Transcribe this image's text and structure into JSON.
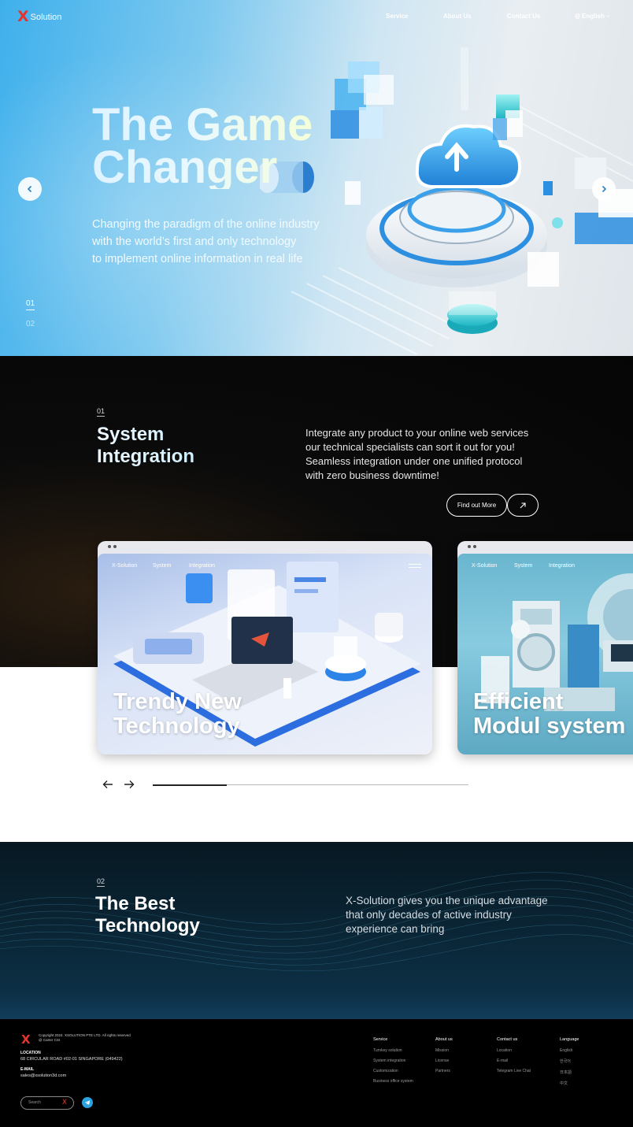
{
  "header": {
    "logo_x": "X",
    "logo_text": "Solution",
    "nav": [
      "Service",
      "About Us",
      "Contact Us"
    ],
    "language": "English"
  },
  "hero": {
    "title": [
      "The Game",
      "Changer"
    ],
    "subtitle": [
      "Changing the paradigm of the online industry",
      "with the world’s first and only technology",
      "to implement online information in real life"
    ],
    "slides": [
      "01",
      "02"
    ],
    "active_slide": "01",
    "prev_icon": "chevron-left-icon",
    "next_icon": "chevron-right-icon"
  },
  "section1": {
    "number": "01",
    "title": [
      "System",
      "Integration"
    ],
    "description": [
      "Integrate any product to your online web services",
      "our technical specialists can sort it out for you!",
      "Seamless integration under one unified protocol",
      "with zero business downtime!"
    ],
    "cta_label": "Find out More",
    "cta_icon": "arrow-up-right-icon",
    "cards": [
      {
        "nav": [
          "X-Solution",
          "System",
          "Integration"
        ],
        "title": [
          "Trendy New",
          "Technology"
        ]
      },
      {
        "nav": [
          "X-Solution",
          "System",
          "Integration"
        ],
        "title": [
          "Efficient",
          "Modul system"
        ]
      }
    ],
    "carousel_progress": 0.235
  },
  "section2": {
    "number": "02",
    "title": [
      "The Best",
      "Technology"
    ],
    "description": [
      "X-Solution gives you the unique advantage",
      "that only decades of active industry",
      "experience can bring"
    ]
  },
  "footer": {
    "copyright": [
      "Copyright 2024. XSOLUTION PTE LTD. All rights reserved",
      "@ Carter CSI"
    ],
    "location_label": "LOCATION",
    "location_value": "68 CIRCULAR ROAD  #02-01   SINGAPORE (049422)",
    "email_label": "E-MAIL",
    "email_value": "sales@xsolution3d.com",
    "search_placeholder": "Search",
    "columns": [
      {
        "heading": "Service",
        "items": [
          "Turnkey solution",
          "System integration",
          "Customization",
          "Business office system"
        ]
      },
      {
        "heading": "About us",
        "items": [
          "Mission",
          "License",
          "Partners"
        ]
      },
      {
        "heading": "Contact us",
        "items": [
          "Location",
          "E-mail",
          "Telegram Live Chat"
        ]
      },
      {
        "heading": "Language",
        "items": [
          "English",
          "한국어",
          "日本語",
          "中文"
        ]
      }
    ]
  },
  "colors": {
    "accent_red": "#e3342f",
    "hero_blue": "#3fb0ec",
    "telegram_blue": "#2aa3e0"
  }
}
